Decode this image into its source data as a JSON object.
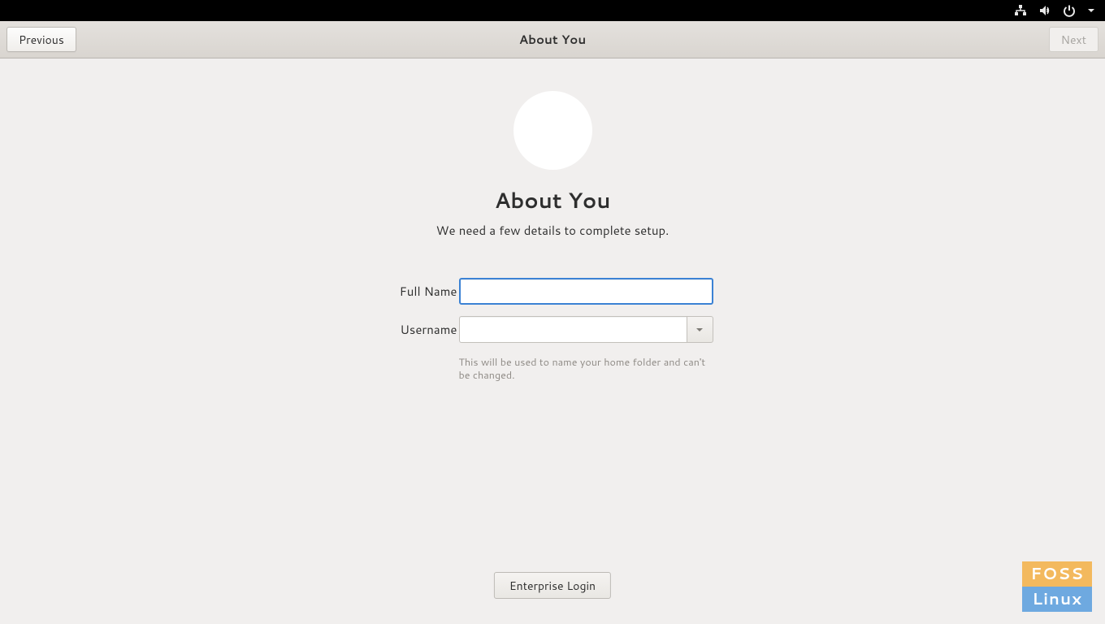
{
  "header": {
    "previous_label": "Previous",
    "title": "About You",
    "next_label": "Next"
  },
  "main": {
    "heading": "About You",
    "subtitle": "We need a few details to complete setup.",
    "full_name_label": "Full Name",
    "full_name_value": "",
    "username_label": "Username",
    "username_value": "",
    "username_hint": "This will be used to name your home folder and can't be changed.",
    "enterprise_label": "Enterprise Login"
  },
  "watermark": {
    "line1": "FOSS",
    "line2": "Linux"
  }
}
